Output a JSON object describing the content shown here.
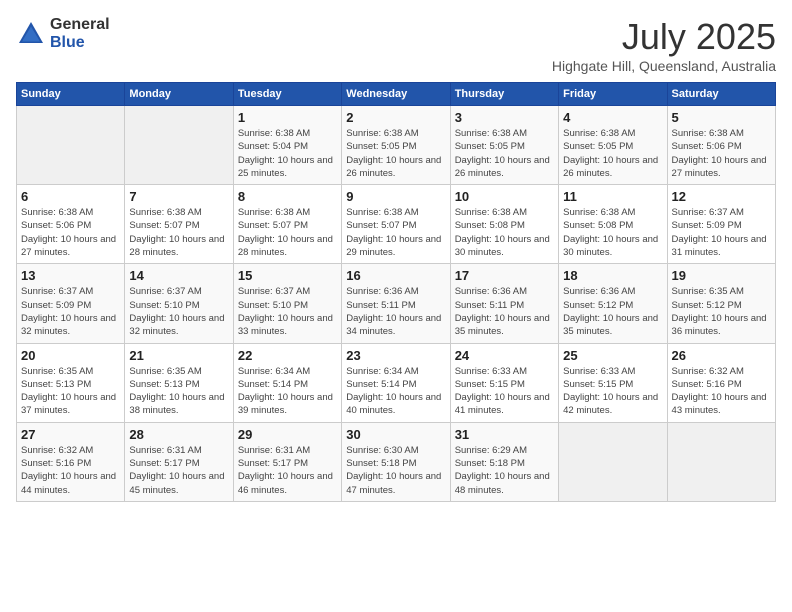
{
  "header": {
    "logo": {
      "general": "General",
      "blue": "Blue"
    },
    "title": "July 2025",
    "location": "Highgate Hill, Queensland, Australia"
  },
  "days_of_week": [
    "Sunday",
    "Monday",
    "Tuesday",
    "Wednesday",
    "Thursday",
    "Friday",
    "Saturday"
  ],
  "weeks": [
    [
      {
        "day": "",
        "sunrise": "",
        "sunset": "",
        "daylight": "",
        "empty": true
      },
      {
        "day": "",
        "sunrise": "",
        "sunset": "",
        "daylight": "",
        "empty": true
      },
      {
        "day": "1",
        "sunrise": "Sunrise: 6:38 AM",
        "sunset": "Sunset: 5:04 PM",
        "daylight": "Daylight: 10 hours and 25 minutes."
      },
      {
        "day": "2",
        "sunrise": "Sunrise: 6:38 AM",
        "sunset": "Sunset: 5:05 PM",
        "daylight": "Daylight: 10 hours and 26 minutes."
      },
      {
        "day": "3",
        "sunrise": "Sunrise: 6:38 AM",
        "sunset": "Sunset: 5:05 PM",
        "daylight": "Daylight: 10 hours and 26 minutes."
      },
      {
        "day": "4",
        "sunrise": "Sunrise: 6:38 AM",
        "sunset": "Sunset: 5:05 PM",
        "daylight": "Daylight: 10 hours and 26 minutes."
      },
      {
        "day": "5",
        "sunrise": "Sunrise: 6:38 AM",
        "sunset": "Sunset: 5:06 PM",
        "daylight": "Daylight: 10 hours and 27 minutes."
      }
    ],
    [
      {
        "day": "6",
        "sunrise": "Sunrise: 6:38 AM",
        "sunset": "Sunset: 5:06 PM",
        "daylight": "Daylight: 10 hours and 27 minutes."
      },
      {
        "day": "7",
        "sunrise": "Sunrise: 6:38 AM",
        "sunset": "Sunset: 5:07 PM",
        "daylight": "Daylight: 10 hours and 28 minutes."
      },
      {
        "day": "8",
        "sunrise": "Sunrise: 6:38 AM",
        "sunset": "Sunset: 5:07 PM",
        "daylight": "Daylight: 10 hours and 28 minutes."
      },
      {
        "day": "9",
        "sunrise": "Sunrise: 6:38 AM",
        "sunset": "Sunset: 5:07 PM",
        "daylight": "Daylight: 10 hours and 29 minutes."
      },
      {
        "day": "10",
        "sunrise": "Sunrise: 6:38 AM",
        "sunset": "Sunset: 5:08 PM",
        "daylight": "Daylight: 10 hours and 30 minutes."
      },
      {
        "day": "11",
        "sunrise": "Sunrise: 6:38 AM",
        "sunset": "Sunset: 5:08 PM",
        "daylight": "Daylight: 10 hours and 30 minutes."
      },
      {
        "day": "12",
        "sunrise": "Sunrise: 6:37 AM",
        "sunset": "Sunset: 5:09 PM",
        "daylight": "Daylight: 10 hours and 31 minutes."
      }
    ],
    [
      {
        "day": "13",
        "sunrise": "Sunrise: 6:37 AM",
        "sunset": "Sunset: 5:09 PM",
        "daylight": "Daylight: 10 hours and 32 minutes."
      },
      {
        "day": "14",
        "sunrise": "Sunrise: 6:37 AM",
        "sunset": "Sunset: 5:10 PM",
        "daylight": "Daylight: 10 hours and 32 minutes."
      },
      {
        "day": "15",
        "sunrise": "Sunrise: 6:37 AM",
        "sunset": "Sunset: 5:10 PM",
        "daylight": "Daylight: 10 hours and 33 minutes."
      },
      {
        "day": "16",
        "sunrise": "Sunrise: 6:36 AM",
        "sunset": "Sunset: 5:11 PM",
        "daylight": "Daylight: 10 hours and 34 minutes."
      },
      {
        "day": "17",
        "sunrise": "Sunrise: 6:36 AM",
        "sunset": "Sunset: 5:11 PM",
        "daylight": "Daylight: 10 hours and 35 minutes."
      },
      {
        "day": "18",
        "sunrise": "Sunrise: 6:36 AM",
        "sunset": "Sunset: 5:12 PM",
        "daylight": "Daylight: 10 hours and 35 minutes."
      },
      {
        "day": "19",
        "sunrise": "Sunrise: 6:35 AM",
        "sunset": "Sunset: 5:12 PM",
        "daylight": "Daylight: 10 hours and 36 minutes."
      }
    ],
    [
      {
        "day": "20",
        "sunrise": "Sunrise: 6:35 AM",
        "sunset": "Sunset: 5:13 PM",
        "daylight": "Daylight: 10 hours and 37 minutes."
      },
      {
        "day": "21",
        "sunrise": "Sunrise: 6:35 AM",
        "sunset": "Sunset: 5:13 PM",
        "daylight": "Daylight: 10 hours and 38 minutes."
      },
      {
        "day": "22",
        "sunrise": "Sunrise: 6:34 AM",
        "sunset": "Sunset: 5:14 PM",
        "daylight": "Daylight: 10 hours and 39 minutes."
      },
      {
        "day": "23",
        "sunrise": "Sunrise: 6:34 AM",
        "sunset": "Sunset: 5:14 PM",
        "daylight": "Daylight: 10 hours and 40 minutes."
      },
      {
        "day": "24",
        "sunrise": "Sunrise: 6:33 AM",
        "sunset": "Sunset: 5:15 PM",
        "daylight": "Daylight: 10 hours and 41 minutes."
      },
      {
        "day": "25",
        "sunrise": "Sunrise: 6:33 AM",
        "sunset": "Sunset: 5:15 PM",
        "daylight": "Daylight: 10 hours and 42 minutes."
      },
      {
        "day": "26",
        "sunrise": "Sunrise: 6:32 AM",
        "sunset": "Sunset: 5:16 PM",
        "daylight": "Daylight: 10 hours and 43 minutes."
      }
    ],
    [
      {
        "day": "27",
        "sunrise": "Sunrise: 6:32 AM",
        "sunset": "Sunset: 5:16 PM",
        "daylight": "Daylight: 10 hours and 44 minutes."
      },
      {
        "day": "28",
        "sunrise": "Sunrise: 6:31 AM",
        "sunset": "Sunset: 5:17 PM",
        "daylight": "Daylight: 10 hours and 45 minutes."
      },
      {
        "day": "29",
        "sunrise": "Sunrise: 6:31 AM",
        "sunset": "Sunset: 5:17 PM",
        "daylight": "Daylight: 10 hours and 46 minutes."
      },
      {
        "day": "30",
        "sunrise": "Sunrise: 6:30 AM",
        "sunset": "Sunset: 5:18 PM",
        "daylight": "Daylight: 10 hours and 47 minutes."
      },
      {
        "day": "31",
        "sunrise": "Sunrise: 6:29 AM",
        "sunset": "Sunset: 5:18 PM",
        "daylight": "Daylight: 10 hours and 48 minutes."
      },
      {
        "day": "",
        "sunrise": "",
        "sunset": "",
        "daylight": "",
        "empty": true
      },
      {
        "day": "",
        "sunrise": "",
        "sunset": "",
        "daylight": "",
        "empty": true
      }
    ]
  ]
}
